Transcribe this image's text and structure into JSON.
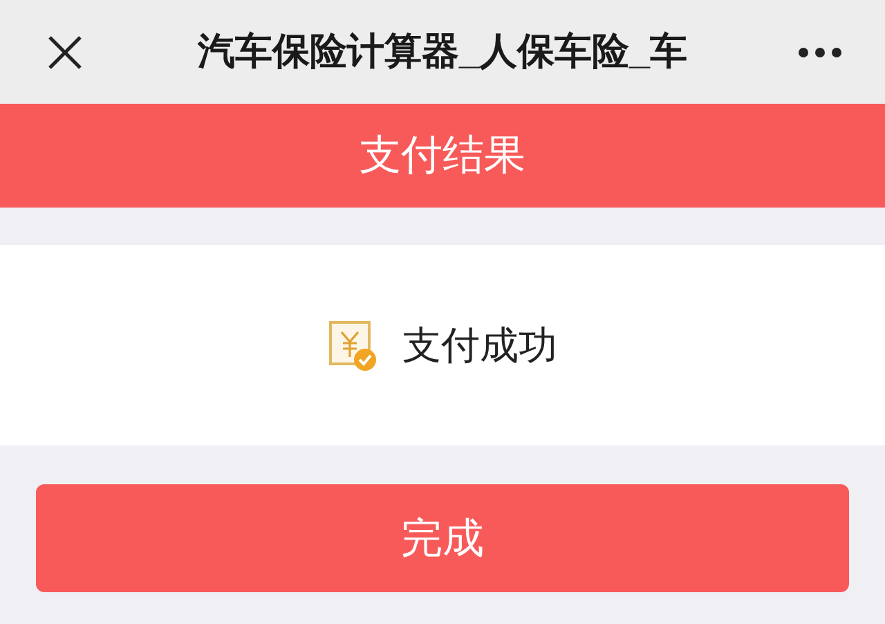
{
  "nav_bar": {
    "title": "汽车保险计算器_人保车险_车"
  },
  "header": {
    "title": "支付结果"
  },
  "result": {
    "message": "支付成功"
  },
  "buttons": [
    "完成"
  ]
}
